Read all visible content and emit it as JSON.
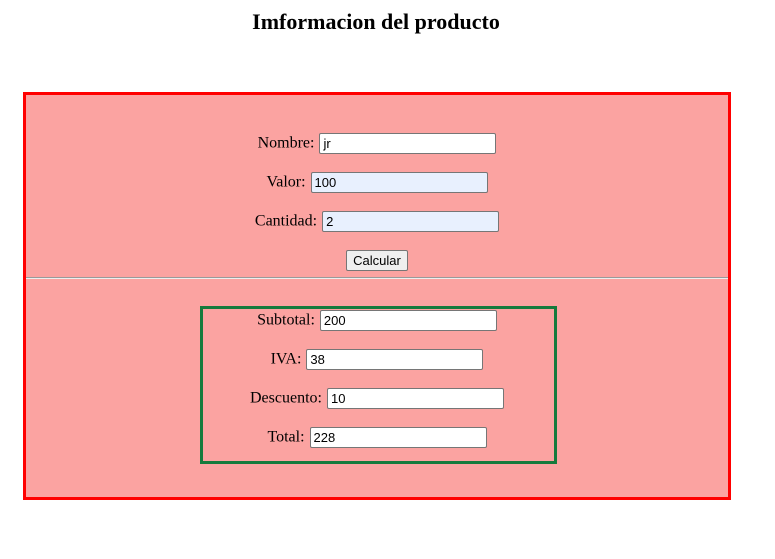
{
  "title": "Imformacion del producto",
  "form": {
    "nombre_label": "Nombre:",
    "nombre_value": "jr",
    "valor_label": "Valor:",
    "valor_value": "100",
    "cantidad_label": "Cantidad:",
    "cantidad_value": "2",
    "calcular_label": "Calcular"
  },
  "results": {
    "subtotal_label": "Subtotal:",
    "subtotal_value": "200",
    "iva_label": "IVA:",
    "iva_value": "38",
    "descuento_label": "Descuento:",
    "descuento_value": "10",
    "total_label": "Total:",
    "total_value": "228"
  },
  "colors": {
    "form_background": "#fba3a1",
    "form_border": "#ff0000",
    "results_border": "#157a3c",
    "autofill_background": "#e8f0fe"
  }
}
